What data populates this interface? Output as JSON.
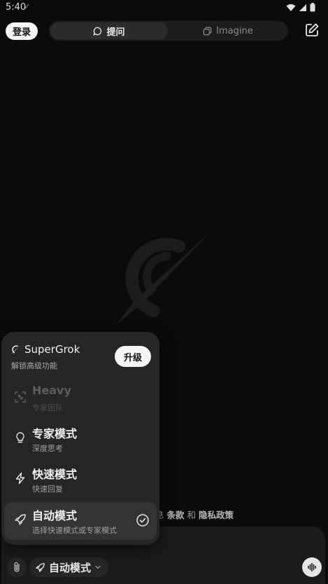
{
  "status_bar": {
    "time": "5:40"
  },
  "header": {
    "login_label": "登录",
    "tabs": [
      {
        "label": "提问",
        "active": true
      },
      {
        "label": "Imagine",
        "active": false
      }
    ]
  },
  "terms_text": {
    "part1": "息",
    "terms": "条款",
    "and": "和",
    "privacy": "隐私政策"
  },
  "mode_menu": {
    "supergrok": {
      "title": "SuperGrok",
      "subtitle": "解锁高级功能",
      "upgrade_label": "升级"
    },
    "items": [
      {
        "title": "Heavy",
        "subtitle": "专家团队",
        "icon": "grid-icon",
        "disabled": true
      },
      {
        "title": "专家模式",
        "subtitle": "深度思考",
        "icon": "lightbulb-icon"
      },
      {
        "title": "快速模式",
        "subtitle": "快速回复",
        "icon": "bolt-icon"
      },
      {
        "title": "自动模式",
        "subtitle": "选择快速模式或专家模式",
        "icon": "rocket-icon",
        "selected": true
      }
    ]
  },
  "input_bar": {
    "mode_label": "自动模式"
  },
  "colors": {
    "background": "#0b0b0b",
    "menu": "#262626",
    "accent_light": "#f5f5f5"
  }
}
